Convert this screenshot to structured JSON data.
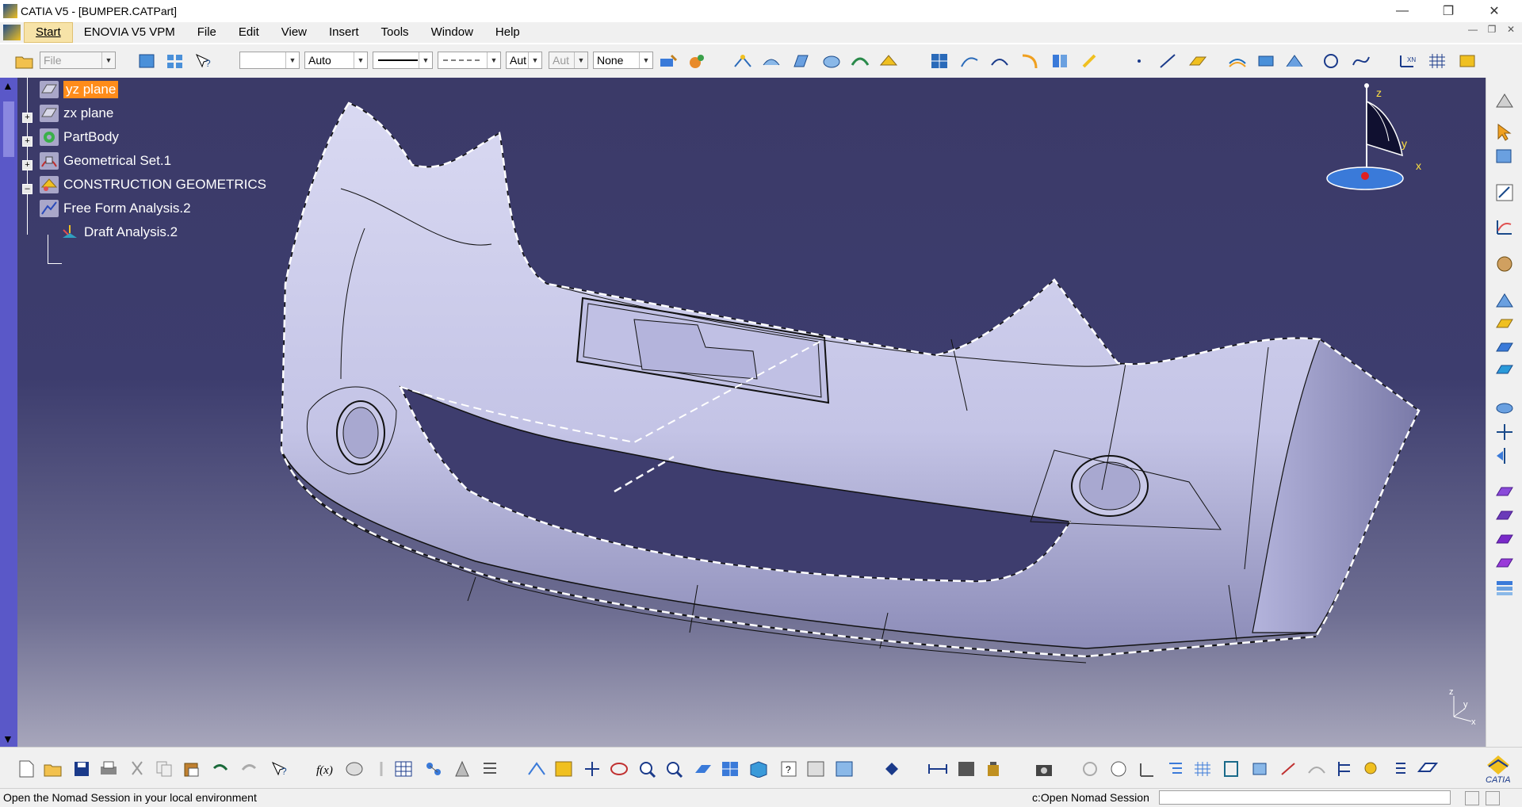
{
  "window": {
    "title": "CATIA V5 - [BUMPER.CATPart]",
    "controls": [
      "minimize",
      "restore",
      "close"
    ]
  },
  "menubar": {
    "items": [
      {
        "label": "Start",
        "key": "start"
      },
      {
        "label": "ENOVIA V5 VPM",
        "key": "enovia"
      },
      {
        "label": "File",
        "key": "file"
      },
      {
        "label": "Edit",
        "key": "edit"
      },
      {
        "label": "View",
        "key": "view"
      },
      {
        "label": "Insert",
        "key": "insert"
      },
      {
        "label": "Tools",
        "key": "tools"
      },
      {
        "label": "Window",
        "key": "window"
      },
      {
        "label": "Help",
        "key": "help"
      }
    ]
  },
  "toolbar": {
    "file_combo": "File",
    "color_combo": "",
    "transparency_combo": "Auto",
    "linetype_combo": "",
    "linedash_combo": "",
    "thickness_combo": "Aut",
    "point_combo": "Aut",
    "layer_combo": "None"
  },
  "tree": {
    "items": [
      {
        "label": "yz plane",
        "icon": "plane-icon"
      },
      {
        "label": "zx plane",
        "icon": "plane-icon"
      },
      {
        "label": "PartBody",
        "icon": "partbody-icon"
      },
      {
        "label": "Geometrical Set.1",
        "icon": "geometrical-set-icon"
      },
      {
        "label": "CONSTRUCTION GEOMETRICS",
        "icon": "construction-icon"
      },
      {
        "label": "Free Form Analysis.2",
        "icon": "analysis-icon"
      },
      {
        "label": "Draft Analysis.2",
        "icon": "draft-analysis-icon"
      }
    ]
  },
  "compass": {
    "x": "x",
    "y": "y",
    "z": "z"
  },
  "mini_axis": {
    "x": "x",
    "y": "y",
    "z": "z"
  },
  "status": {
    "message": "Open the Nomad Session in your local environment",
    "command": "c:Open Nomad Session",
    "input_value": ""
  },
  "colors": {
    "viewport_top": "#3b3a68",
    "viewport_bottom": "#a7a6bb",
    "selection": "#ff8c1a",
    "part_surface": "#c8c8e8"
  }
}
